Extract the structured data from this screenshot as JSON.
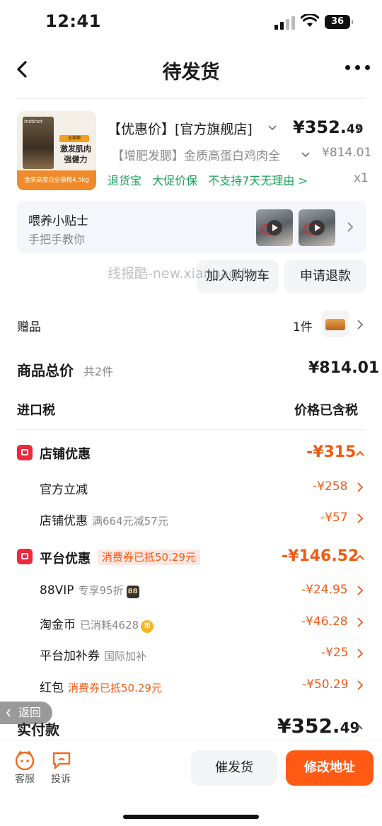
{
  "status": {
    "time": "12:41",
    "battery": "36"
  },
  "nav": {
    "title": "待发货"
  },
  "product": {
    "title": "【优惠价】[官方旗舰店]",
    "price_int": "¥352.",
    "price_dec": "49",
    "subtitle": "【增肥发腮】金质高蛋白鸡肉全",
    "original_price": "¥814.01",
    "quantity": "x1",
    "tags": [
      "退货宝",
      "大促价保",
      "不支持7天无理由 >"
    ],
    "thumbnail": {
      "brand": "Instinct",
      "badge": "全猫粮",
      "promo_line1": "激发肌肉",
      "promo_line2": "强健力",
      "band": "金质高蛋白全猫粮4.5kg"
    }
  },
  "tips": {
    "title": "喂养小贴士",
    "subtitle": "手把手教你"
  },
  "actions": {
    "add_cart": "加入购物车",
    "refund": "申请退款"
  },
  "watermark": "线报酷-new.xianbao.fun",
  "gift": {
    "label": "赠品",
    "count": "1件"
  },
  "summary": {
    "total_label": "商品总价",
    "total_count": "共2件",
    "total_value": "¥814.01",
    "tax_label": "进口税",
    "tax_value": "价格已含税"
  },
  "store_discount": {
    "title": "店铺优惠",
    "value": "-¥315",
    "items": [
      {
        "label": "官方立减",
        "note": "",
        "value": "-¥258"
      },
      {
        "label": "店铺优惠",
        "note": "满664元减57元",
        "value": "-¥57"
      }
    ]
  },
  "platform_discount": {
    "title": "平台优惠",
    "badge": "消费券已抵50.29元",
    "value": "-¥146.52",
    "items": [
      {
        "label": "88VIP",
        "note": "专享95折",
        "badge": "88",
        "value": "-¥24.95"
      },
      {
        "label": "淘金币",
        "note": "已消耗4628",
        "badge": "币",
        "value": "-¥46.28"
      },
      {
        "label": "平台加补券",
        "note": "国际加补",
        "value": "-¥25"
      },
      {
        "label": "红包",
        "note": "消费券已抵50.29元",
        "value": "-¥50.29"
      }
    ]
  },
  "back_pill": "返回",
  "payment": {
    "label": "实付款",
    "value_int": "¥352.",
    "value_dec": "49"
  },
  "bottom": {
    "service_label": "客服",
    "complain_label": "投诉",
    "urge_label": "催发货",
    "modify_label": "修改地址"
  },
  "colors": {
    "accent": "#ff5a14",
    "discount": "#f05a14",
    "green": "#18a058",
    "badge_red": "#ee2a3a"
  }
}
